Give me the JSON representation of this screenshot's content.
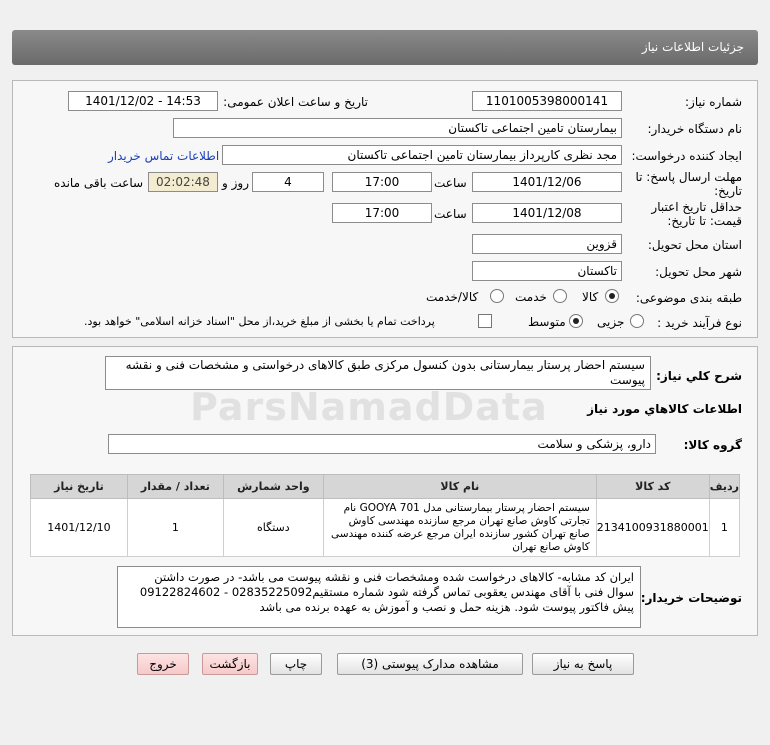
{
  "header": {
    "title": "جزئیات اطلاعات نیاز"
  },
  "fields": {
    "need_number_label": "شماره نیاز:",
    "need_number": "1101005398000141",
    "announce_label": "تاریخ و ساعت اعلان عمومی:",
    "announce_value": "1401/12/02 - 14:53",
    "buyer_org_label": "نام دستگاه خریدار:",
    "buyer_org": "بیمارستان تامین اجتماعی تاکستان",
    "requester_label": "ایجاد کننده درخواست:",
    "requester": "مجد نظری کارپرداز بیمارستان تامین اجتماعی تاکستان",
    "contact_link": "اطلاعات تماس خریدار",
    "reply_deadline_label_1": "مهلت ارسال پاسخ: تا",
    "reply_deadline_label_2": "تاریخ:",
    "reply_date": "1401/12/06",
    "time_label": "ساعت",
    "reply_time": "17:00",
    "days_value": "4",
    "days_label": "روز و",
    "remaining_time": "02:02:48",
    "remaining_label": "ساعت باقی مانده",
    "validity_label_1": "حداقل تاریخ اعتبار",
    "validity_label_2": "قیمت: تا تاریخ:",
    "validity_date": "1401/12/08",
    "validity_time": "17:00",
    "province_label": "استان محل تحویل:",
    "province": "قزوین",
    "city_label": "شهر محل تحویل:",
    "city": "تاکستان",
    "category_label": "طبقه بندی موضوعی:",
    "category_options": [
      "کالا",
      "خدمت",
      "کالا/خدمت"
    ],
    "process_label": "نوع فرآیند خرید :",
    "process_options": [
      "جزیی",
      "متوسط"
    ],
    "treasury_note": "پرداخت تمام یا بخشی از مبلغ خرید،از محل \"اسناد خزانه اسلامی\" خواهد بود."
  },
  "summary": {
    "label": "شرح کلي نياز:",
    "text": "سیستم احضار پرستار بیمارستانی بدون کنسول مرکزی طبق کالاهای درخواستی و مشخصات فنی و نقشه پیوست"
  },
  "goods": {
    "section_title": "اطلاعات کالاهاي مورد نياز",
    "group_label": "گروه کالا:",
    "group_value": "دارو، پزشکی و سلامت",
    "columns": [
      "ردیف",
      "کد کالا",
      "نام کالا",
      "واحد شمارش",
      "تعداد / مقدار",
      "تاریخ نیاز"
    ],
    "rows": [
      {
        "row": "1",
        "code": "2134100931880001",
        "name": "سیستم احضار پرستار بیمارستانی مدل GOOYA 701 نام تجارتی کاوش صانع تهران مرجع سازنده مهندسی کاوش صانع تهران کشور سازنده ایران مرجع عرضه کننده مهندسی کاوش صانع تهران",
        "unit": "دستگاه",
        "qty": "1",
        "date": "1401/12/10"
      }
    ]
  },
  "buyer_notes": {
    "label": "توضیحات خریدار:",
    "text": "ایران کد مشابه- کالاهای درخواست شده ومشخصات فنی و نقشه پیوست می باشد- در صورت داشتن سوال فنی با آقای مهندس یعقوبی تماس گرفته شود شماره مستقیم02835225092 - 09122824602 پیش فاکتور پیوست شود. هزینه حمل و نصب و آموزش به عهده برنده می باشد"
  },
  "buttons": {
    "reply": "پاسخ به نیاز",
    "docs": "مشاهده مدارک پیوستی (3)",
    "print": "چاپ",
    "back": "بازگشت",
    "exit": "خروج"
  },
  "watermark": "ParsNamadData"
}
